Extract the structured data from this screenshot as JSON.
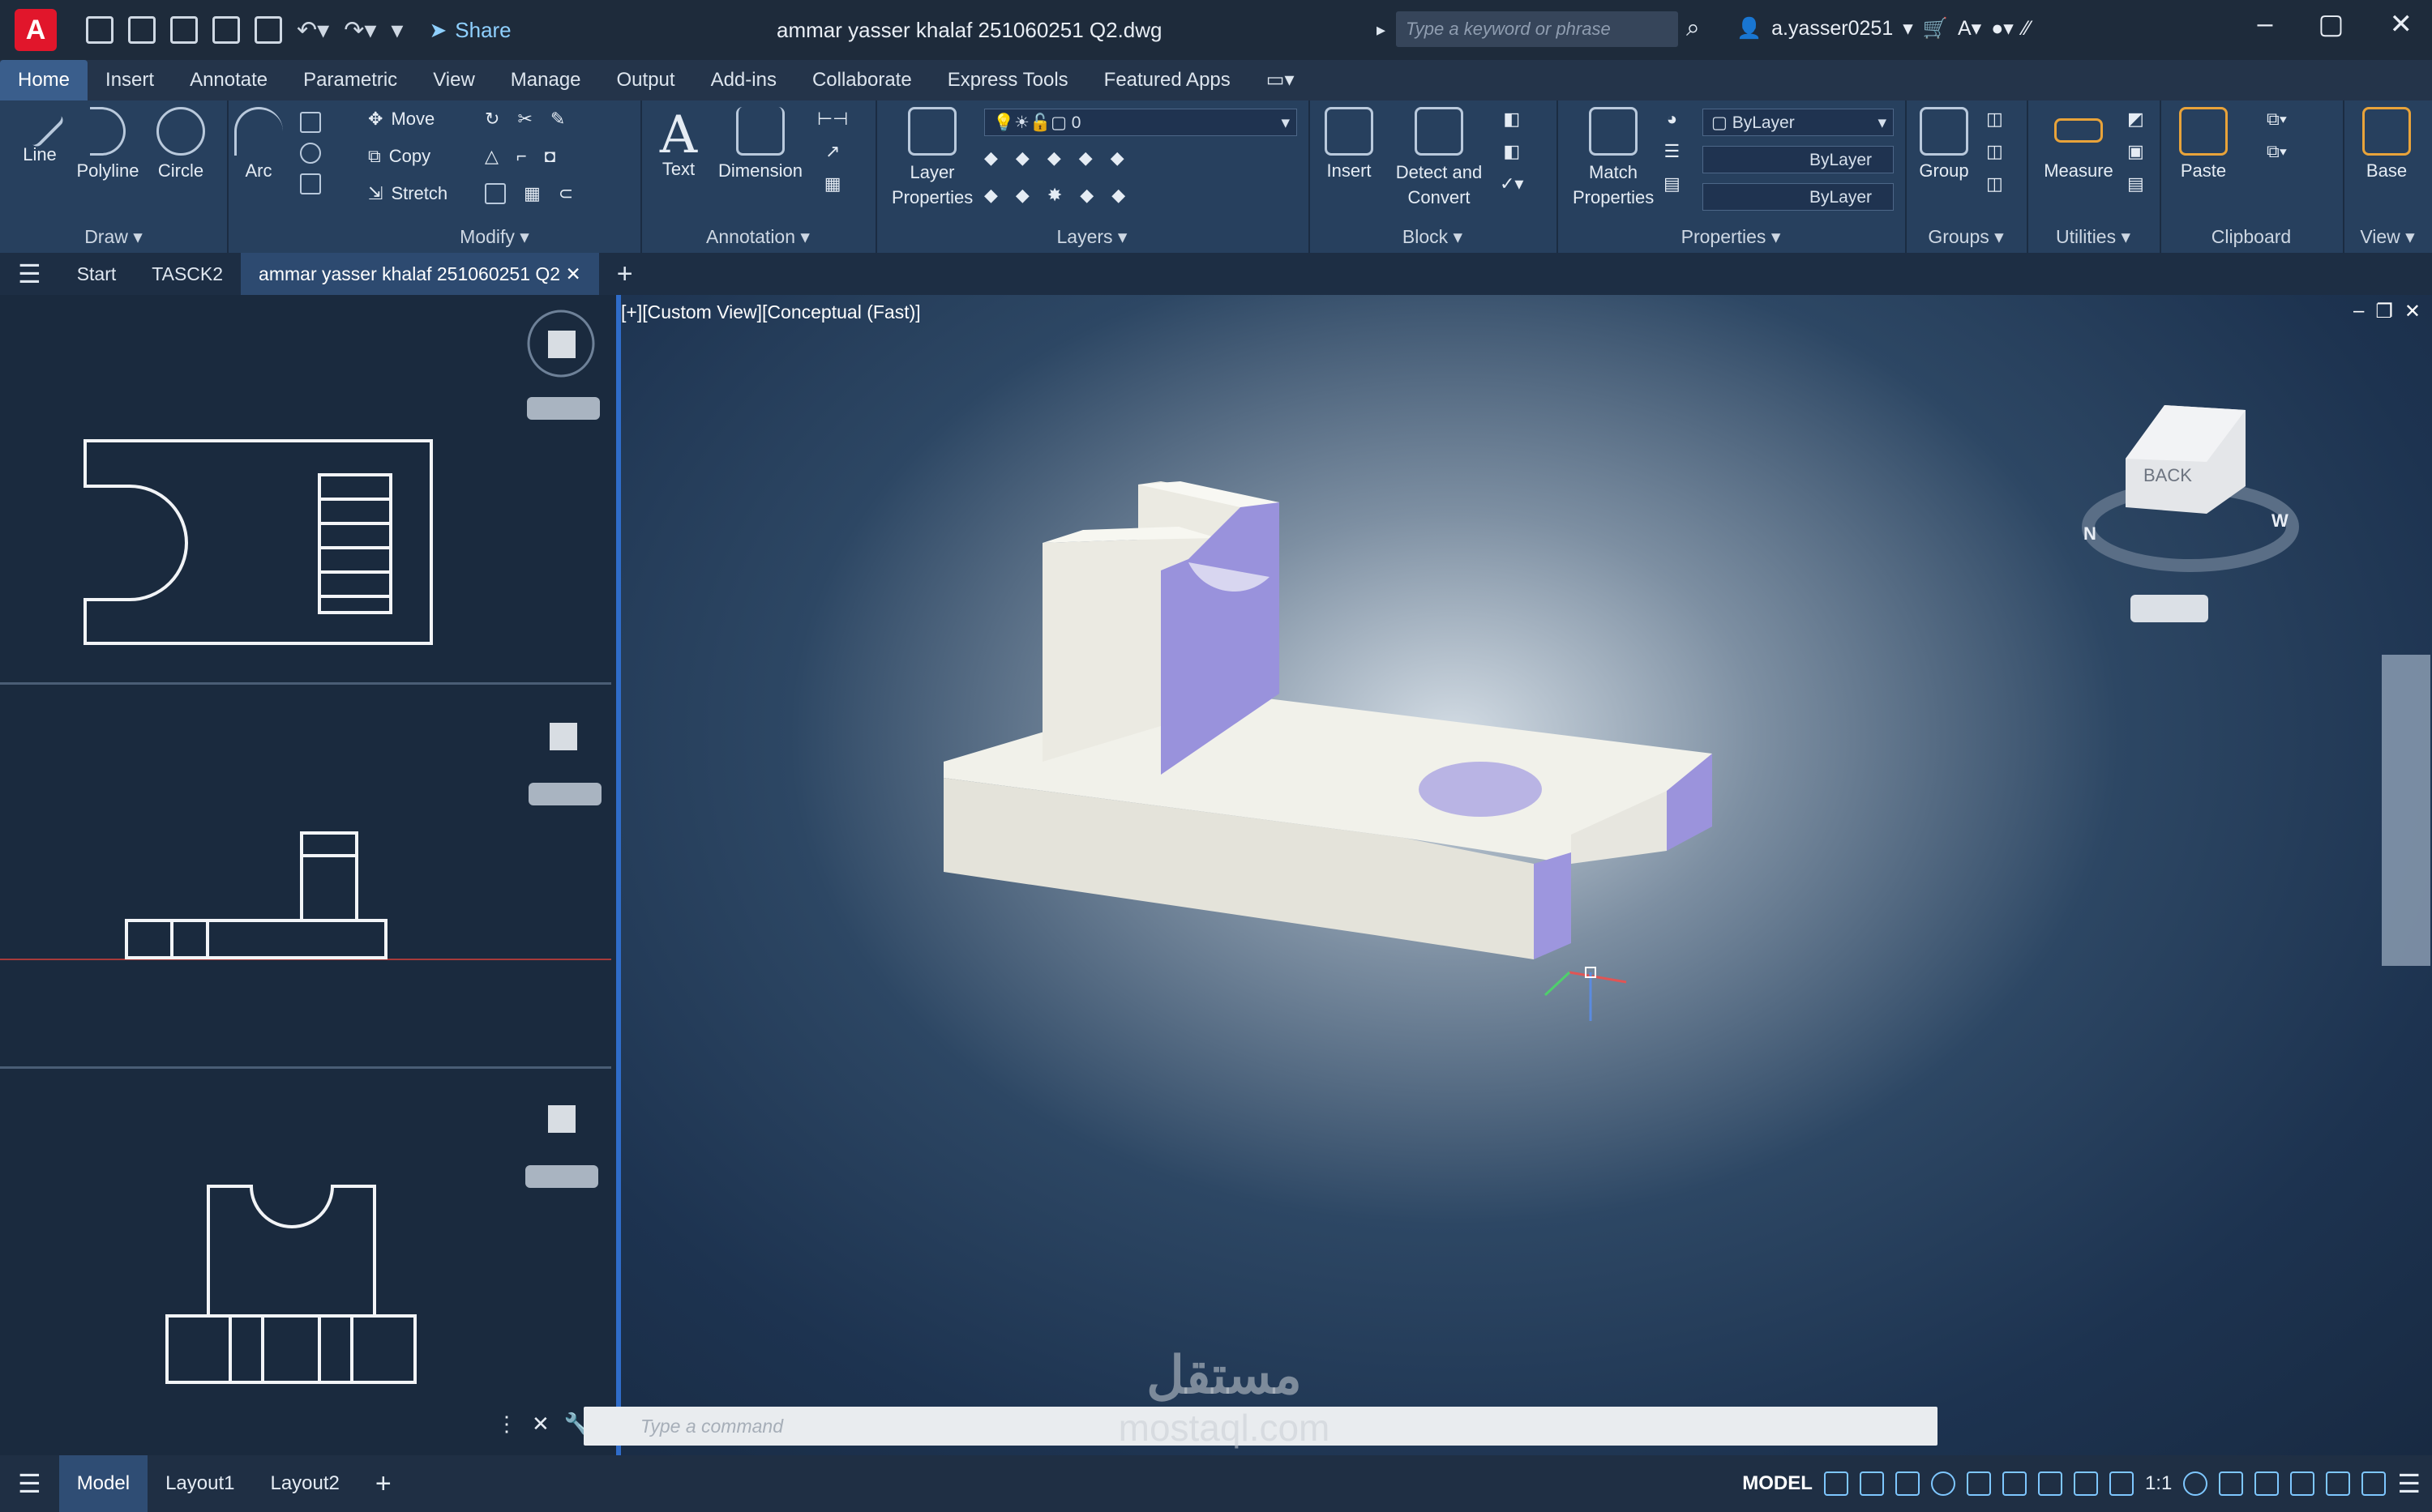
{
  "title_bar": {
    "logo": "A",
    "share_label": "Share",
    "document_title": "ammar yasser khalaf 251060251 Q2.dwg",
    "search_placeholder": "Type a keyword or phrase",
    "username": "a.yasser0251"
  },
  "menu_tabs": [
    "Home",
    "Insert",
    "Annotate",
    "Parametric",
    "View",
    "Manage",
    "Output",
    "Add-ins",
    "Collaborate",
    "Express Tools",
    "Featured Apps"
  ],
  "ribbon": {
    "draw": {
      "label": "Draw",
      "tools": [
        "Line",
        "Polyline",
        "Circle",
        "Arc"
      ]
    },
    "modify": {
      "label": "Modify",
      "tools": [
        "Move",
        "Copy",
        "Stretch"
      ]
    },
    "annotation": {
      "label": "Annotation",
      "tools": [
        "Text",
        "Dimension"
      ]
    },
    "layers": {
      "label": "Layers",
      "tool": "Layer Properties",
      "current_layer": "0"
    },
    "block": {
      "label": "Block",
      "insert": "Insert",
      "detect": "Detect and Convert"
    },
    "properties": {
      "label": "Properties",
      "match": "Match Properties",
      "color": "ByLayer",
      "linetype": "ByLayer",
      "lineweight": "ByLayer"
    },
    "groups": {
      "label": "Groups",
      "tool": "Group"
    },
    "utilities": {
      "label": "Utilities",
      "tool": "Measure"
    },
    "clipboard": {
      "label": "Clipboard",
      "tool": "Paste"
    },
    "view": {
      "label": "View",
      "tool": "Base"
    }
  },
  "file_tabs": [
    "Start",
    "TASCK2",
    "ammar yasser khalaf 251060251 Q2"
  ],
  "viewport_label": "[+][Custom View][Conceptual (Fast)]",
  "viewcube": {
    "face": "BACK",
    "compass_n": "N",
    "compass_w": "W"
  },
  "command_placeholder": "Type a command",
  "layout_tabs": [
    "Model",
    "Layout1",
    "Layout2"
  ],
  "status": {
    "mode": "MODEL",
    "scale": "1:1"
  },
  "watermark": {
    "arabic": "مستقل",
    "latin": "mostaql.com"
  },
  "colors": {
    "accent": "#2f6cc9",
    "ribbon": "#27405e",
    "solid_face": "#e9e9e2",
    "cut_face": "#9a93dc"
  }
}
